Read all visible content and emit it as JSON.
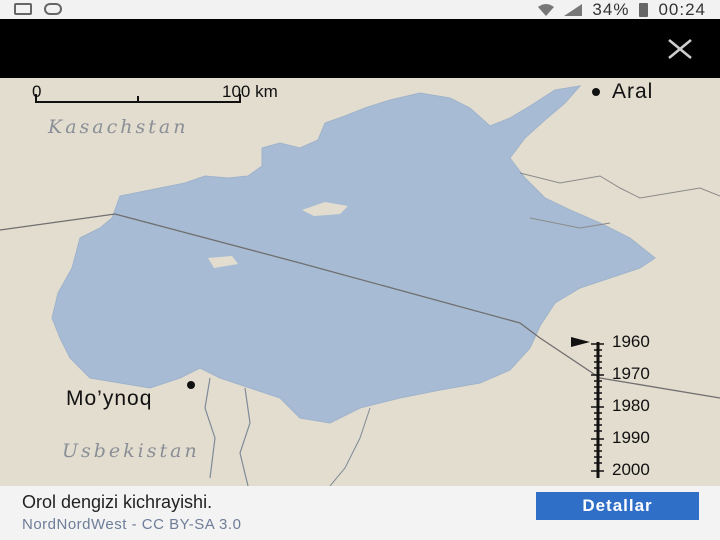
{
  "status_bar": {
    "battery_percent": "34%",
    "time": "00:24"
  },
  "viewer": {
    "close_icon": "close-icon"
  },
  "map": {
    "scale": {
      "zero": "0",
      "distance": "100 km"
    },
    "labels": {
      "country_north": "Kasachstan",
      "country_south": "Usbekistan",
      "city_aral": "Aral",
      "city_moynoq": "Mo’ynoq"
    },
    "timeline": {
      "years": [
        "1960",
        "1970",
        "1980",
        "1990",
        "2000"
      ],
      "current_year": "1960"
    },
    "colors": {
      "land": "#e3ddcf",
      "water": "#a7bcd4",
      "border": "#7a7a7a"
    }
  },
  "footer": {
    "caption": "Orol dengizi kichrayishi.",
    "attribution": "NordNordWest - CC BY-SA 3.0",
    "details_label": "Detallar"
  }
}
